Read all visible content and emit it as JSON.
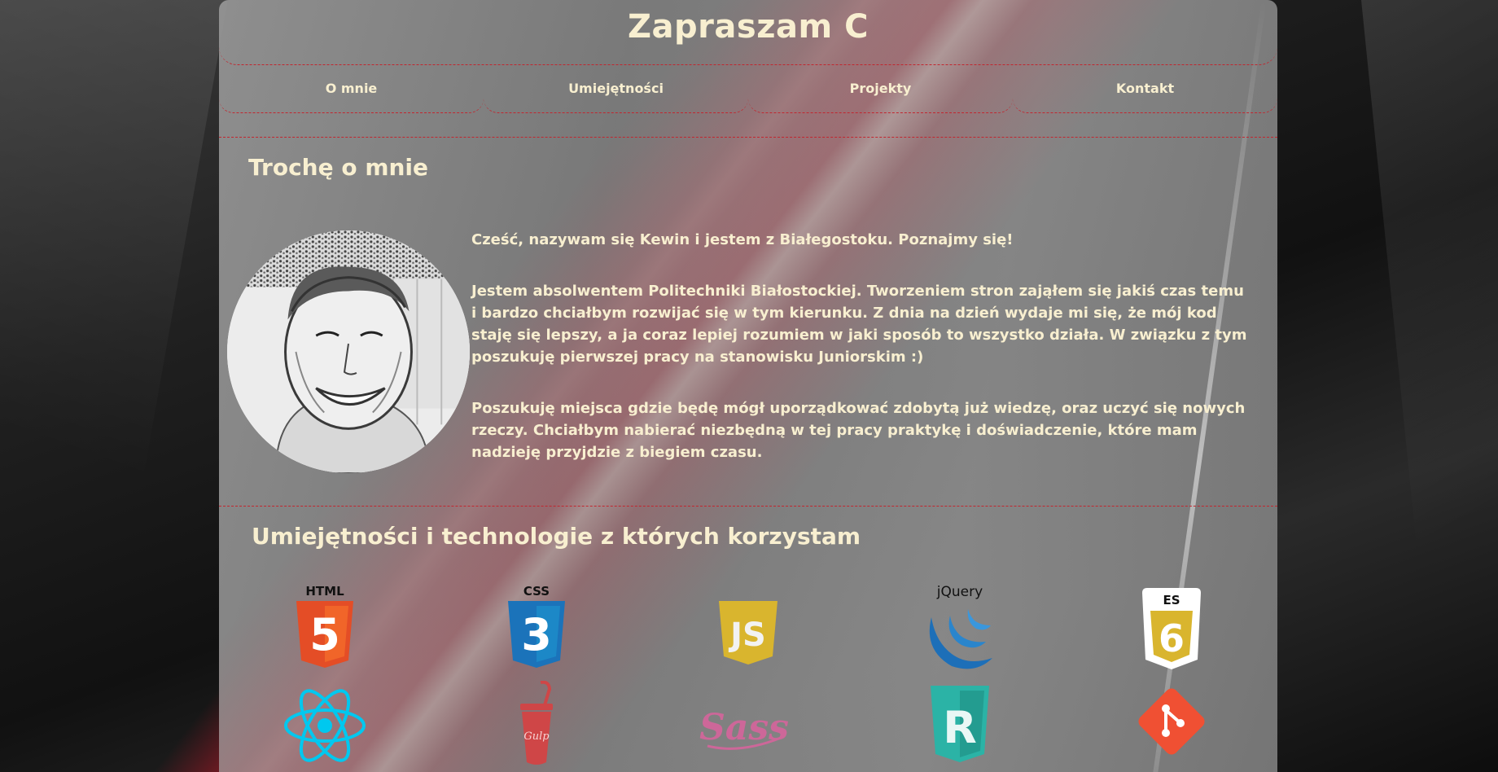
{
  "header": {
    "title": "Zapraszam C"
  },
  "nav": [
    {
      "label": "O mnie"
    },
    {
      "label": "Umiejętności"
    },
    {
      "label": "Projekty"
    },
    {
      "label": "Kontakt"
    }
  ],
  "about": {
    "heading": "Trochę o mnie",
    "paragraphs": [
      "Cześć, nazywam się Kewin i jestem z Białegostoku. Poznajmy się!",
      "Jestem absolwentem Politechniki Białostockiej. Tworzeniem stron zająłem się jakiś czas temu i bardzo chciałbym rozwijać się w tym kierunku. Z dnia na dzień wydaje mi się, że mój kod staję się lepszy, a ja coraz lepiej rozumiem w jaki sposób to wszystko działa. W związku z tym poszukuję pierwszej pracy na stanowisku Juniorskim :)",
      "Poszukuję miejsca gdzie będę mógł uporządkować zdobytą już wiedzę, oraz uczyć się nowych rzeczy. Chciałbym nabierać niezbędną w tej pracy praktykę i doświadczenie, które mam nadzieję przyjdzie z biegiem czasu."
    ]
  },
  "skills": {
    "heading": "Umiejętności i technologie z których korzystam",
    "icons": [
      {
        "name": "html5-icon",
        "badge": "HTML",
        "glyph": "5",
        "color": "#e44d26"
      },
      {
        "name": "css3-icon",
        "badge": "CSS",
        "glyph": "3",
        "color": "#1b73ba"
      },
      {
        "name": "javascript-icon",
        "badge": "",
        "glyph": "JS",
        "color": "#d9b52e"
      },
      {
        "name": "jquery-icon",
        "badge": "jQuery",
        "glyph": "",
        "color": "#1d6fb8"
      },
      {
        "name": "es6-icon",
        "badge": "ES",
        "glyph": "6",
        "color": "#d9b52e"
      },
      {
        "name": "react-icon",
        "badge": "",
        "glyph": "",
        "color": "#00c8ef"
      },
      {
        "name": "gulp-icon",
        "badge": "",
        "glyph": "Gulp",
        "color": "#cf4647"
      },
      {
        "name": "sass-icon",
        "badge": "",
        "glyph": "Sass",
        "color": "#cd6799"
      },
      {
        "name": "rwd-icon",
        "badge": "",
        "glyph": "R",
        "color": "#2bb3a6"
      },
      {
        "name": "git-icon",
        "badge": "",
        "glyph": "",
        "color": "#f05033"
      }
    ]
  }
}
